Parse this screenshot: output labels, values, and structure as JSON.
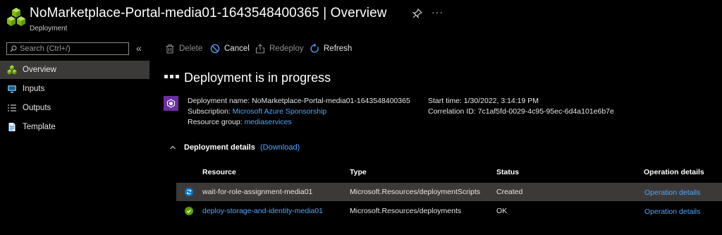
{
  "header": {
    "title": "NoMarketplace-Portal-media01-1643548400365 | Overview",
    "subtitle": "Deployment",
    "more": "···"
  },
  "sidebar": {
    "search_placeholder": "Search (Ctrl+/)",
    "collapse": "«",
    "items": [
      {
        "label": "Overview",
        "icon": "deployment-icon",
        "active": true
      },
      {
        "label": "Inputs",
        "icon": "inputs-icon",
        "active": false
      },
      {
        "label": "Outputs",
        "icon": "outputs-icon",
        "active": false
      },
      {
        "label": "Template",
        "icon": "template-icon",
        "active": false
      }
    ]
  },
  "toolbar": {
    "delete": "Delete",
    "cancel": "Cancel",
    "redeploy": "Redeploy",
    "refresh": "Refresh"
  },
  "status": {
    "title": "Deployment is in progress"
  },
  "info": {
    "deployment_name_label": "Deployment name:",
    "deployment_name": "NoMarketplace-Portal-media01-1643548400365",
    "subscription_label": "Subscription:",
    "subscription": "Microsoft Azure Sponsorship",
    "resource_group_label": "Resource group:",
    "resource_group": "mediaservices",
    "start_time_label": "Start time:",
    "start_time": "1/30/2022, 3:14:19 PM",
    "correlation_id_label": "Correlation ID:",
    "correlation_id": "7c1af5fd-0029-4c95-95ec-6d4a101e6b7e"
  },
  "details": {
    "title": "Deployment details",
    "download": "(Download)",
    "columns": [
      "Resource",
      "Type",
      "Status",
      "Operation details"
    ],
    "rows": [
      {
        "resource": "wait-for-role-assignment-media01",
        "type": "Microsoft.Resources/deploymentScripts",
        "status": "Created",
        "operation": "Operation details",
        "icon": "in-progress-icon",
        "selected": true
      },
      {
        "resource": "deploy-storage-and-identity-media01",
        "type": "Microsoft.Resources/deployments",
        "status": "OK",
        "operation": "Operation details",
        "icon": "success-check-icon",
        "selected": false
      }
    ]
  },
  "colors": {
    "background": "#000000",
    "selected_row": "#3b3a39",
    "link": "#4fa7ff",
    "accent": "#0078d4",
    "success": "#57a300",
    "deployment_icon": "#6b2fa0"
  }
}
